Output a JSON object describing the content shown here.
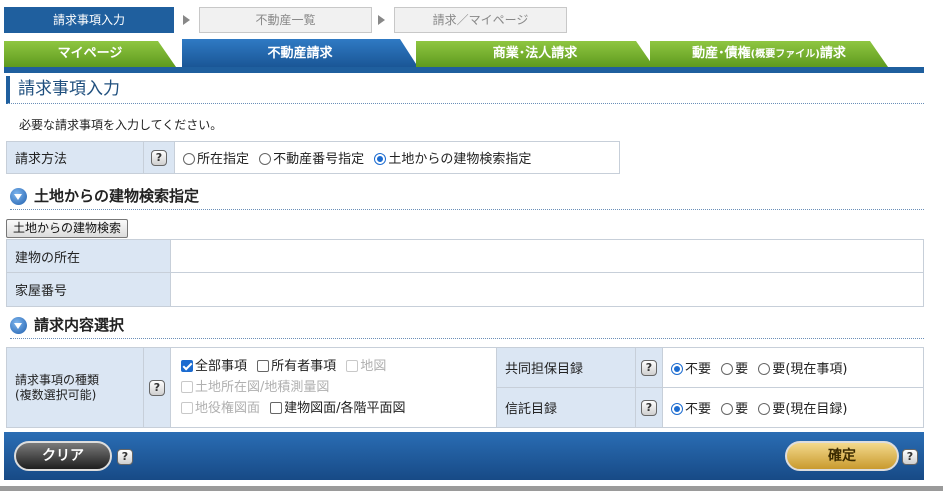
{
  "steps": [
    "請求事項入力",
    "不動産一覧",
    "請求／マイページ"
  ],
  "tabs": {
    "mypage": "マイページ",
    "realestate": "不動産請求",
    "commercial": "商業･法人請求",
    "movable_main": "動産･債権",
    "movable_small": "(概要ファイル)",
    "movable_suffix": "請求"
  },
  "page_title": "請求事項入力",
  "intro": "必要な請求事項を入力してください。",
  "help_glyph": "?",
  "method": {
    "label": "請求方法",
    "options": [
      "所在指定",
      "不動産番号指定",
      "土地からの建物検索指定"
    ]
  },
  "section1": "土地からの建物検索指定",
  "search_button": "土地からの建物検索",
  "building_location": "建物の所在",
  "house_number": "家屋番号",
  "section2": "請求内容選択",
  "request_type": {
    "label_line1": "請求事項の種類",
    "label_line2": "(複数選択可能)",
    "items": [
      "全部事項",
      "所有者事項",
      "地図",
      "土地所在図/地積測量図",
      "地役権図面",
      "建物図面/各階平面図"
    ]
  },
  "joint_collateral": {
    "label": "共同担保目録",
    "options": [
      "不要",
      "要",
      "要(現在事項)"
    ]
  },
  "trust": {
    "label": "信託目録",
    "options": [
      "不要",
      "要",
      "要(現在目録)"
    ]
  },
  "buttons": {
    "clear": "クリア",
    "confirm": "確定"
  }
}
